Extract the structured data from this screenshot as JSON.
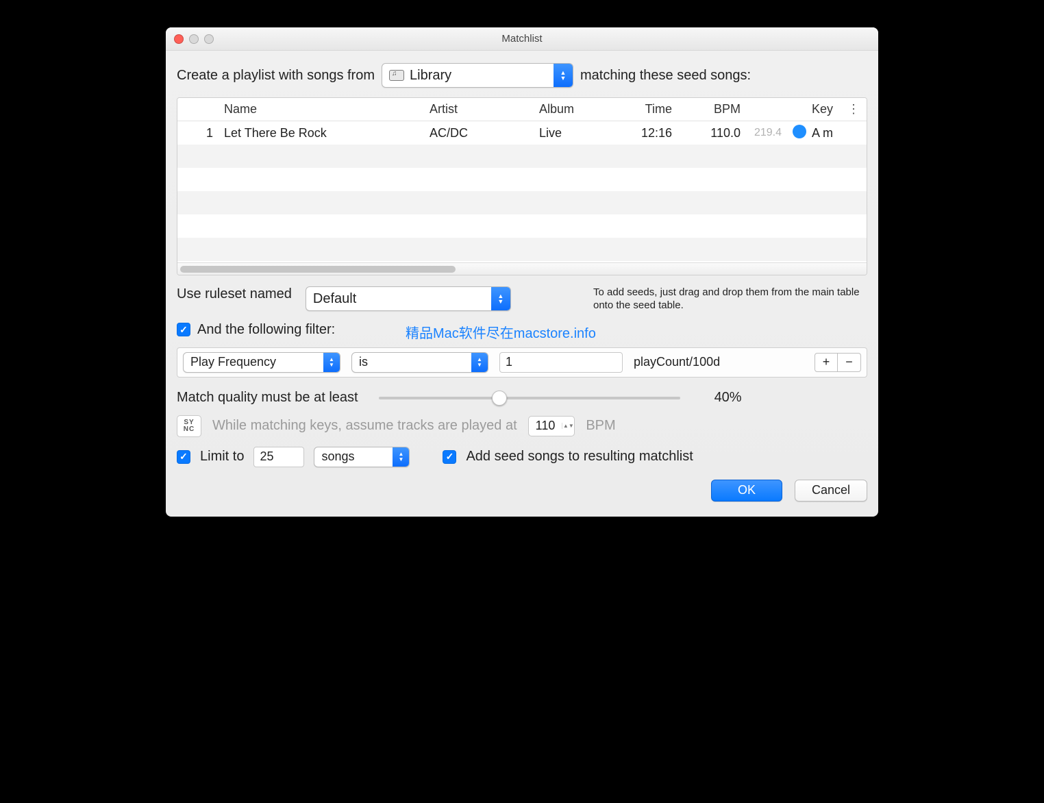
{
  "window": {
    "title": "Matchlist"
  },
  "prompt": {
    "prefix": "Create a playlist with songs from",
    "source": "Library",
    "suffix": "matching these seed songs:"
  },
  "table": {
    "headers": {
      "name": "Name",
      "artist": "Artist",
      "album": "Album",
      "time": "Time",
      "bpm": "BPM",
      "key": "Key",
      "menu": "⋮"
    },
    "rows": [
      {
        "idx": "1",
        "name": "Let There Be Rock",
        "artist": "AC/DC",
        "album": "Live",
        "time": "12:16",
        "bpm": "110.0",
        "bpm2": "219.4",
        "key": "A m"
      }
    ]
  },
  "ruleset": {
    "label": "Use ruleset named",
    "value": "Default",
    "hint": "To add seeds, just drag and drop them from the main table onto the seed table."
  },
  "watermark": "精品Mac软件尽在macstore.info",
  "filterToggle": {
    "label": "And the following filter:"
  },
  "filter": {
    "field": "Play Frequency",
    "op": "is",
    "value": "1",
    "unit": "playCount/100d",
    "plus": "+",
    "minus": "−"
  },
  "quality": {
    "label": "Match quality must be at least",
    "percent": 40,
    "display": "40%"
  },
  "sync": {
    "badge_top": "SY",
    "badge_bot": "NC",
    "label": "While matching keys, assume tracks are played at",
    "bpm": "110",
    "unit": "BPM"
  },
  "limit": {
    "label": "Limit to",
    "value": "25",
    "unit": "songs"
  },
  "addSeed": {
    "label": "Add seed songs to resulting matchlist"
  },
  "buttons": {
    "ok": "OK",
    "cancel": "Cancel"
  }
}
